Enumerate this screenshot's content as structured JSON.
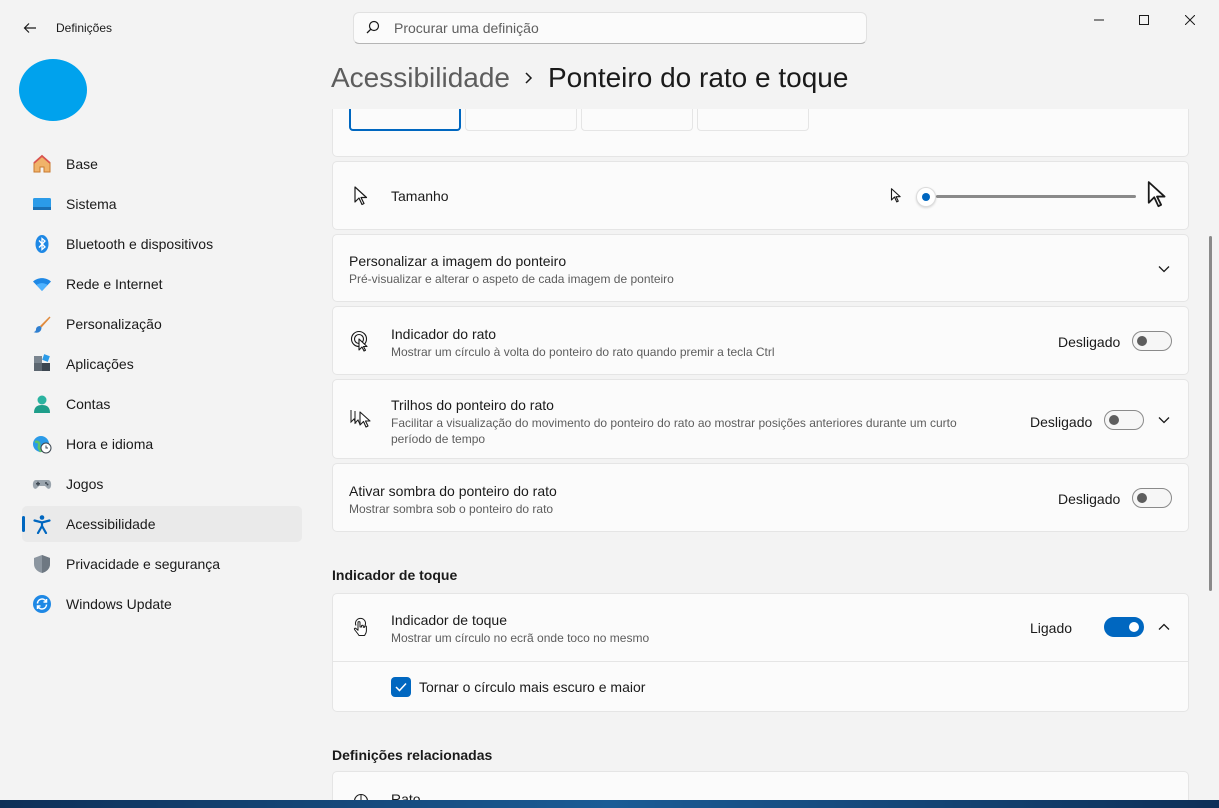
{
  "app": {
    "title": "Definições",
    "search_placeholder": "Procurar uma definição"
  },
  "window_controls": [
    "minimize-icon",
    "maximize-icon",
    "close-icon"
  ],
  "sidebar": {
    "items": [
      {
        "label": "Base",
        "icon": "home-icon"
      },
      {
        "label": "Sistema",
        "icon": "system-icon"
      },
      {
        "label": "Bluetooth e dispositivos",
        "icon": "bluetooth-icon"
      },
      {
        "label": "Rede e Internet",
        "icon": "wifi-icon"
      },
      {
        "label": "Personalização",
        "icon": "brush-icon"
      },
      {
        "label": "Aplicações",
        "icon": "apps-icon"
      },
      {
        "label": "Contas",
        "icon": "account-icon"
      },
      {
        "label": "Hora e idioma",
        "icon": "globe-clock-icon"
      },
      {
        "label": "Jogos",
        "icon": "gamepad-icon"
      },
      {
        "label": "Acessibilidade",
        "icon": "accessibility-icon",
        "active": true
      },
      {
        "label": "Privacidade e segurança",
        "icon": "shield-icon"
      },
      {
        "label": "Windows Update",
        "icon": "update-icon"
      }
    ]
  },
  "header": {
    "parent": "Acessibilidade",
    "current": "Ponteiro do rato e toque"
  },
  "cards": {
    "size": {
      "title": "Tamanho",
      "slider_value": 0
    },
    "custom_image": {
      "title": "Personalizar a imagem do ponteiro",
      "desc": "Pré-visualizar e alterar o aspeto de cada imagem de ponteiro"
    },
    "mouse_indicator": {
      "title": "Indicador do rato",
      "desc": "Mostrar um círculo à volta do ponteiro do rato quando premir a tecla Ctrl",
      "state": "Desligado"
    },
    "trails": {
      "title": "Trilhos do ponteiro do rato",
      "desc_line1": "Facilitar a visualização do movimento do ponteiro do rato ao mostrar posições anteriores durante um curto",
      "desc_line2": "período de tempo",
      "state": "Desligado"
    },
    "shadow": {
      "title": "Ativar sombra do ponteiro do rato",
      "desc": "Mostrar sombra sob o ponteiro do rato",
      "state": "Desligado"
    }
  },
  "touch_section": {
    "header": "Indicador de toque",
    "card": {
      "title": "Indicador de toque",
      "desc": "Mostrar um círculo no ecrã onde toco no mesmo",
      "state": "Ligado",
      "checkbox_label": "Tornar o círculo mais escuro e maior",
      "checkbox_checked": true
    }
  },
  "related": {
    "header": "Definições relacionadas",
    "first_item": "Rato"
  },
  "colors": {
    "accent": "#0067c0",
    "avatar": "#00a2ed"
  }
}
